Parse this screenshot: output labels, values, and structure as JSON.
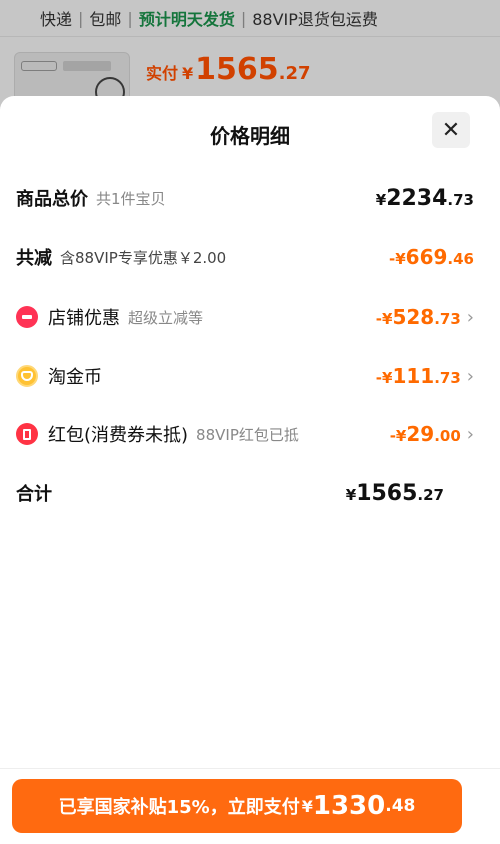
{
  "background": {
    "shipping": {
      "express": "快递",
      "free": "包邮",
      "eta": "预计明天发货",
      "vip": "88VIP退货包运费"
    },
    "pay": {
      "label": "实付",
      "symbol": "¥",
      "integer": "1565",
      "decimal": ".27"
    }
  },
  "sheet": {
    "title": "价格明细",
    "close_label": "✕",
    "rows": {
      "total": {
        "label": "商品总价",
        "sub": "共1件宝贝",
        "symbol": "¥",
        "integer": "2234",
        "decimal": ".73"
      },
      "reduce": {
        "label": "共减",
        "sub": "含88VIP专享优惠￥2.00",
        "symbol": "-¥",
        "integer": "669",
        "decimal": ".46"
      },
      "store": {
        "label": "店铺优惠",
        "sub": "超级立减等",
        "symbol": "-¥",
        "integer": "528",
        "decimal": ".73",
        "icon": "store-icon"
      },
      "coin": {
        "label": "淘金币",
        "symbol": "-¥",
        "integer": "111",
        "decimal": ".73",
        "icon": "coin-icon"
      },
      "redpacket": {
        "label": "红包(消费券未抵)",
        "sub": "88VIP红包已抵",
        "symbol": "-¥",
        "integer": "29",
        "decimal": ".00",
        "icon": "red-packet-icon"
      },
      "sum": {
        "label": "合计",
        "symbol": "¥",
        "integer": "1565",
        "decimal": ".27"
      }
    }
  },
  "bottom": {
    "button": {
      "text": "已享国家补贴15%，立即支付",
      "symbol": "¥",
      "integer": "1330",
      "decimal": ".48"
    }
  },
  "colors": {
    "accent": "#ff6a10",
    "discount": "#ff6a00",
    "eta_green": "#1a8f4a"
  }
}
